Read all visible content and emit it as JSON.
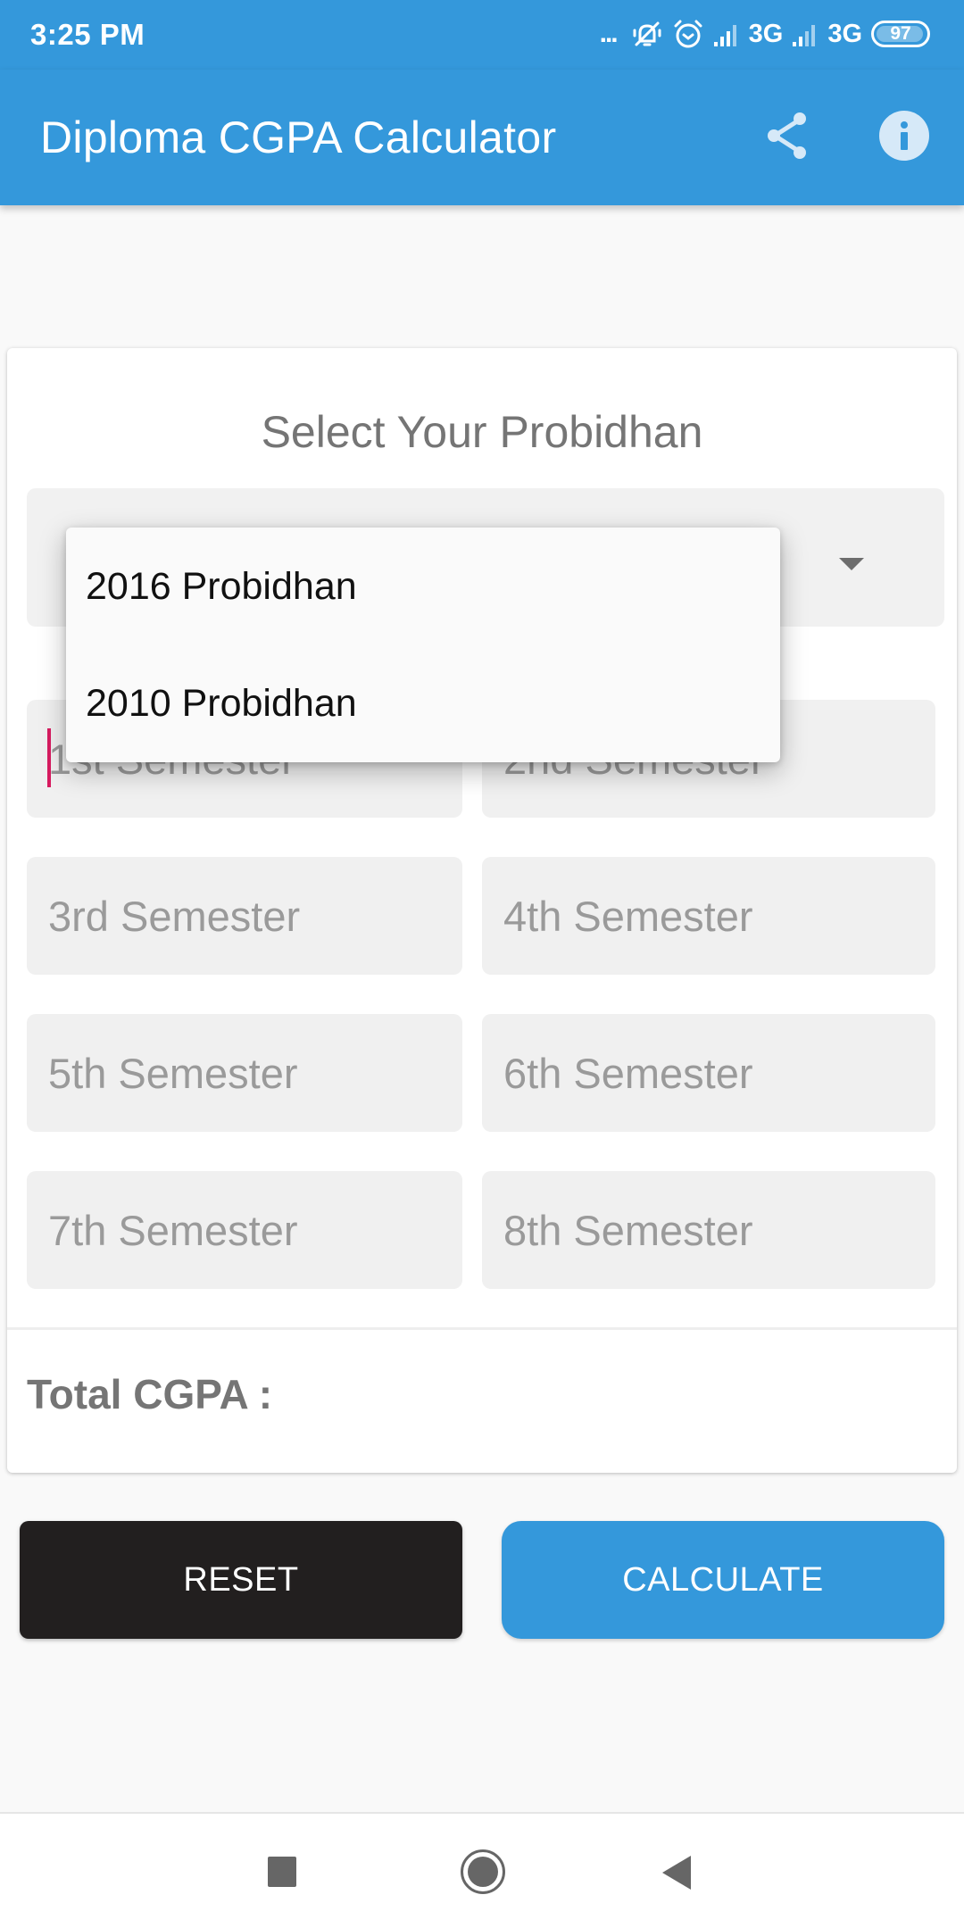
{
  "status_bar": {
    "time": "3:25 PM",
    "overflow_dots": "...",
    "icons": [
      "notification-overflow-icon",
      "bell-muted-icon",
      "alarm-icon",
      "signal-icon",
      "signal-icon"
    ],
    "network_1": "3G",
    "network_2": "3G",
    "battery_level": "97",
    "battery_percent": 97
  },
  "app_bar": {
    "title": "Diploma CGPA Calculator",
    "actions": [
      "share-icon",
      "info-icon"
    ],
    "color": "#3498db"
  },
  "card": {
    "heading": "Select Your Probidhan",
    "spinner": {
      "selected": "",
      "options": [
        "2016 Probidhan",
        "2010 Probidhan"
      ]
    },
    "semesters": [
      {
        "placeholder": "1st Semester",
        "value": ""
      },
      {
        "placeholder": "2nd Semester",
        "value": ""
      },
      {
        "placeholder": "3rd Semester",
        "value": ""
      },
      {
        "placeholder": "4th Semester",
        "value": ""
      },
      {
        "placeholder": "5th Semester",
        "value": ""
      },
      {
        "placeholder": "6th Semester",
        "value": ""
      },
      {
        "placeholder": "7th Semester",
        "value": ""
      },
      {
        "placeholder": "8th Semester",
        "value": ""
      }
    ],
    "total_label": "Total CGPA :",
    "total_value": ""
  },
  "buttons": {
    "reset": "RESET",
    "calculate": "CALCULATE",
    "reset_color": "#221f1f",
    "calculate_color": "#3498db"
  },
  "cursor_color": "#d81b60",
  "nav_bar": {
    "buttons": [
      "recents-icon",
      "home-icon",
      "back-icon"
    ]
  }
}
